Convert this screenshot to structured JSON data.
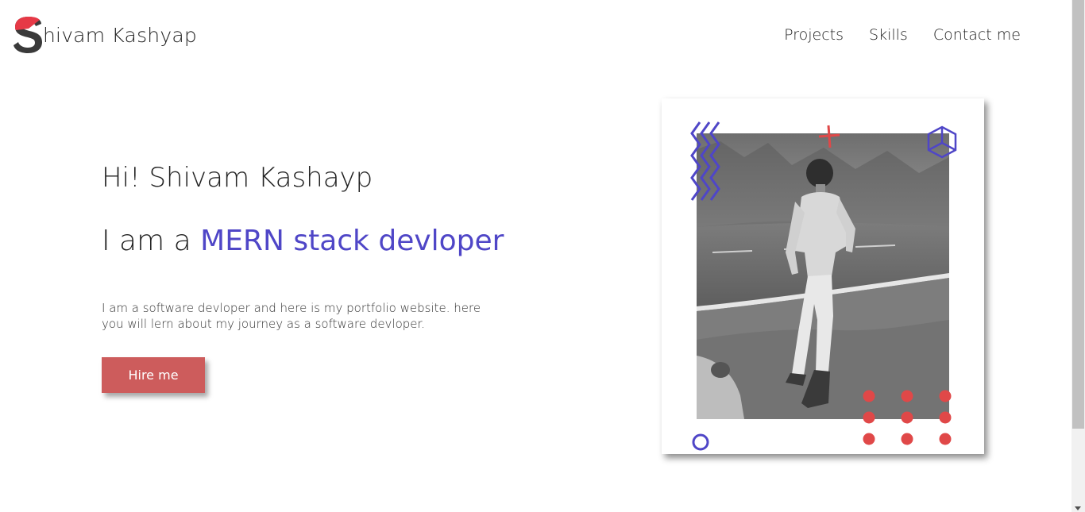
{
  "header": {
    "logo_text": "hivam Kashyap",
    "nav": [
      {
        "label": "Projects"
      },
      {
        "label": "Skills"
      },
      {
        "label": "Contact me"
      }
    ]
  },
  "hero": {
    "greeting": "Hi! Shivam Kashayp",
    "role_prefix": "I am a ",
    "role_highlight": "MERN stack devloper",
    "description": "I am a software devloper and here is my portfolio website. here you will lern about my journey as a software devloper.",
    "cta_label": "Hire me"
  },
  "colors": {
    "accent": "#4f46c7",
    "button": "#cd5c5c",
    "logo_red": "#e63946",
    "dots": "#e04848"
  }
}
